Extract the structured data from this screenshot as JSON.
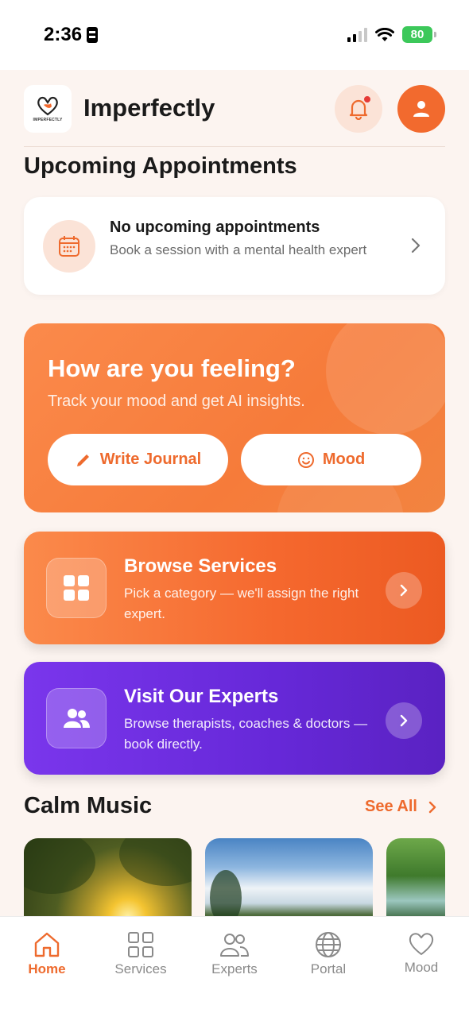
{
  "status_bar": {
    "time": "2:36",
    "battery": "80"
  },
  "header": {
    "app_name": "Imperfectly",
    "logo_text": "IMPERFECTLY"
  },
  "appointments": {
    "section_title": "Upcoming Appointments",
    "empty_title": "No upcoming appointments",
    "empty_subtitle": "Book a session with a mental health expert"
  },
  "feeling": {
    "title": "How are you feeling?",
    "subtitle": "Track your mood and get AI insights.",
    "journal_label": "Write Journal",
    "mood_label": "Mood"
  },
  "services_card": {
    "title": "Browse Services",
    "description": "Pick a category — we'll assign the right expert.",
    "color": "#f5682e"
  },
  "experts_card": {
    "title": "Visit Our Experts",
    "description": "Browse therapists, coaches & doctors — book directly.",
    "color": "#6628d8"
  },
  "calm_music": {
    "section_title": "Calm Music",
    "see_all": "See All"
  },
  "nav": {
    "items": [
      {
        "label": "Home",
        "icon": "home-icon",
        "active": true
      },
      {
        "label": "Services",
        "icon": "grid-icon",
        "active": false
      },
      {
        "label": "Experts",
        "icon": "people-icon",
        "active": false
      },
      {
        "label": "Portal",
        "icon": "globe-icon",
        "active": false
      },
      {
        "label": "Mood",
        "icon": "heart-icon",
        "active": false
      }
    ]
  },
  "accent_color": "#ee6a2d"
}
